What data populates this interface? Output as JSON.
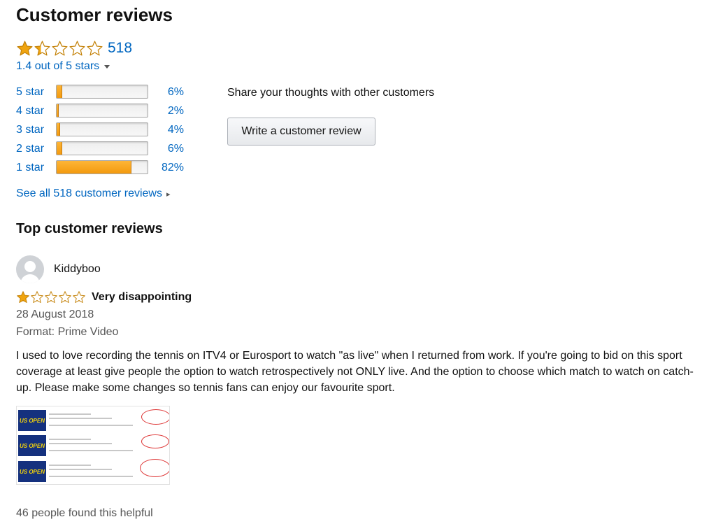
{
  "section": {
    "title": "Customer reviews"
  },
  "summary": {
    "rating": 1.4,
    "total_count": "518",
    "average_text": "1.4 out of 5 stars",
    "star_color": "#f0a40f"
  },
  "histogram": [
    {
      "label": "5 star",
      "percent": 6,
      "percent_text": "6%"
    },
    {
      "label": "4 star",
      "percent": 2,
      "percent_text": "2%"
    },
    {
      "label": "3 star",
      "percent": 4,
      "percent_text": "4%"
    },
    {
      "label": "2 star",
      "percent": 6,
      "percent_text": "6%"
    },
    {
      "label": "1 star",
      "percent": 82,
      "percent_text": "82%"
    }
  ],
  "see_all": "See all 518 customer reviews",
  "share": {
    "prompt": "Share your thoughts with other customers",
    "button_label": "Write a customer review"
  },
  "top_reviews": {
    "title": "Top customer reviews",
    "review": {
      "author": "Kiddyboo",
      "rating": 1,
      "title": "Very disappointing",
      "date": "28 August 2018",
      "format": "Format: Prime Video",
      "body": "I used to love recording the tennis on ITV4 or Eurosport to watch \"as live\" when I returned from work. If you're going to bid on this sport coverage at least give people the option to watch retrospectively not ONLY live. And the option to choose which match to watch on catch-up. Please make some changes so tennis fans can enjoy our favourite sport.",
      "image_badge": "US OPEN",
      "helpful": "46 people found this helpful"
    }
  }
}
